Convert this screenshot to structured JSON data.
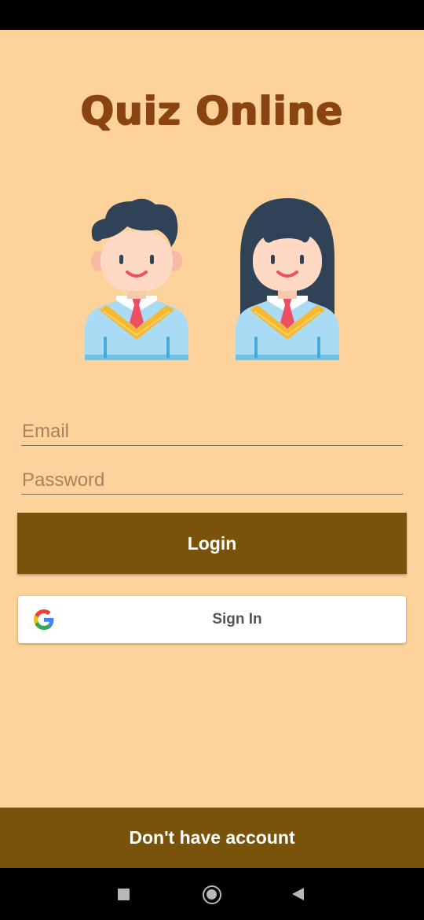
{
  "app": {
    "title": "Quiz Online"
  },
  "illustrations": {
    "left": "boy-student-icon",
    "right": "girl-student-icon"
  },
  "form": {
    "email": {
      "value": "",
      "placeholder": "Email"
    },
    "password": {
      "value": "",
      "placeholder": "Password"
    }
  },
  "buttons": {
    "login_label": "Login",
    "google_label": "Sign In",
    "google_icon": "google-icon",
    "signup_label": "Don't have account"
  },
  "navigation": {
    "recents_icon": "square-recents-icon",
    "home_icon": "circle-home-icon",
    "back_icon": "triangle-back-icon"
  },
  "colors": {
    "background": "#fdd29b",
    "title": "#8a4410",
    "primary_button": "#7a530a",
    "button_text": "#ffffff",
    "google_blue": "#4285F4",
    "google_red": "#EA4335",
    "google_yellow": "#FBBC05",
    "google_green": "#34A853"
  }
}
